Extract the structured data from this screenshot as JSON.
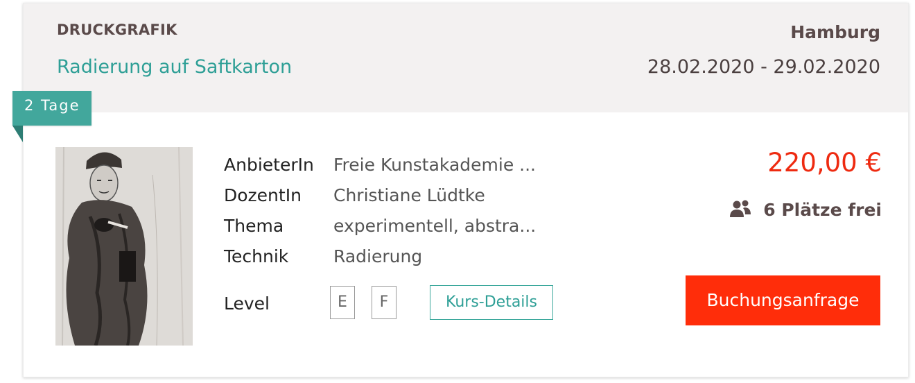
{
  "course": {
    "category": "DRUCKGRAFIK",
    "title": "Radierung auf Saftkarton",
    "city": "Hamburg",
    "dates": "28.02.2020 - 29.02.2020",
    "duration_badge": "2 Tage"
  },
  "info": {
    "provider_label": "AnbieterIn",
    "provider_value": "Freie Kunstakademie ...",
    "lecturer_label": "DozentIn",
    "lecturer_value": "Christiane Lüdtke",
    "topic_label": "Thema",
    "topic_value": "experimentell, abstra...",
    "technique_label": "Technik",
    "technique_value": "Radierung",
    "level_label": "Level",
    "levels": [
      "E",
      "F"
    ]
  },
  "actions": {
    "details_label": "Kurs-Details",
    "book_label": "Buchungsanfrage"
  },
  "pricing": {
    "price": "220,00 €",
    "seats": "6 Plätze frei"
  },
  "icons": {
    "seats_icon": "users-icon",
    "thumbnail": "course-artwork-image"
  },
  "colors": {
    "accent_teal": "#2e9f96",
    "price_red": "#ee2a10",
    "button_red": "#ff2d0a",
    "header_bg": "#f3f1f1"
  }
}
